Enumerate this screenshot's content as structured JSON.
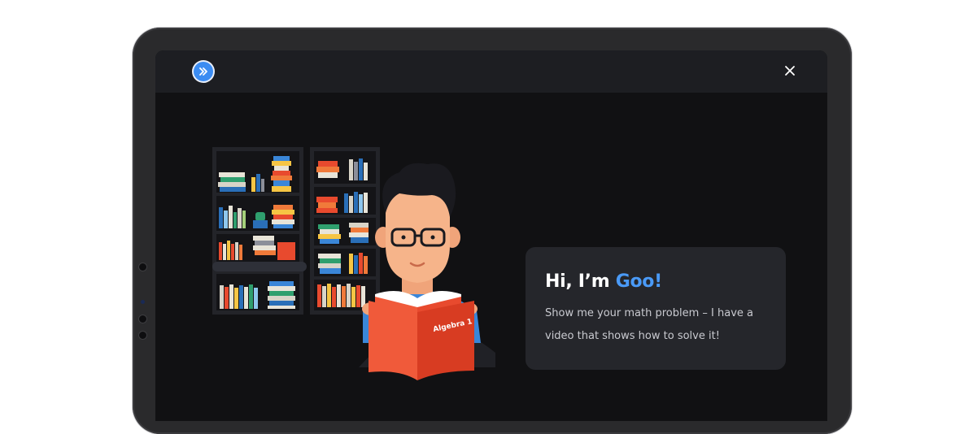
{
  "window": {
    "go_button_icon": "double-chevron-right-icon",
    "close_icon": "close-icon"
  },
  "illustration": {
    "book_title": "Algebra 1"
  },
  "greeting": {
    "prefix": "Hi, I’m ",
    "name": "Goo!",
    "message": "Show me your math problem – I have a video that shows how to solve it!"
  },
  "colors": {
    "accent": "#4a9af7",
    "button": "#3b8cf2",
    "screen_bg": "#111113",
    "topbar_bg": "#1d1e22",
    "card_bg": "#25262b",
    "book_red": "#e84a2e"
  }
}
